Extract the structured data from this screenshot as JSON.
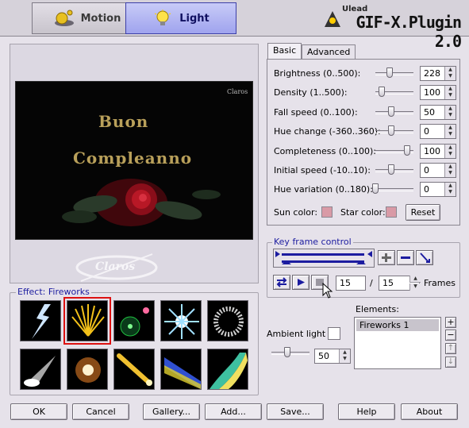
{
  "header": {
    "tabs": [
      {
        "label": "Motion",
        "active": false
      },
      {
        "label": "Light",
        "active": true
      }
    ],
    "brand_small": "Ulead",
    "brand_title": "GIF-X.Plugin 2.0"
  },
  "preview": {
    "watermark": "Claros",
    "line1": "Buon",
    "line2": "Compleanno",
    "logo_text": "Claros"
  },
  "effects": {
    "title": "Effect: Fireworks",
    "selected_index": 1,
    "thumbnails": [
      "lightning-icon",
      "fireworks-icon",
      "glow-orb-icon",
      "star-burst-icon",
      "ring-icon",
      "spotlight-icon",
      "flare-icon",
      "comet-icon",
      "light-beam-icon",
      "aurora-icon"
    ]
  },
  "param_tabs": [
    {
      "label": "Basic",
      "active": true
    },
    {
      "label": "Advanced",
      "active": false
    }
  ],
  "params": [
    {
      "label": "Brightness (0..500):",
      "value": "228",
      "level": 0.46
    },
    {
      "label": "Density (1..500):",
      "value": "100",
      "level": 0.2
    },
    {
      "label": "Fall speed (0..100):",
      "value": "50",
      "level": 0.5
    },
    {
      "label": "Hue change (-360..360):",
      "value": "0",
      "level": 0.5
    },
    {
      "label": "Completeness (0..100):",
      "value": "100",
      "level": 1.0
    },
    {
      "label": "Initial speed (-10..10):",
      "value": "0",
      "level": 0.5
    },
    {
      "label": "Hue variation (0..180):",
      "value": "0",
      "level": 0.0
    }
  ],
  "colors": {
    "sun_label": "Sun color:",
    "star_label": "Star color:",
    "sun_color": "#d99aa6",
    "star_color": "#d99aa6",
    "reset_label": "Reset"
  },
  "keyframe": {
    "title": "Key frame control",
    "current_frame": "15",
    "separator": "/",
    "total_frames": "15",
    "frames_label": "Frames"
  },
  "ambient": {
    "label": "Ambient light",
    "value": "50",
    "level": 0.5
  },
  "elements": {
    "label": "Elements:",
    "items": [
      "Fireworks 1"
    ],
    "side_buttons": [
      "+",
      "−",
      "↑",
      "↓"
    ]
  },
  "buttons": {
    "ok": "OK",
    "cancel": "Cancel",
    "gallery": "Gallery...",
    "add": "Add...",
    "save": "Save...",
    "help": "Help",
    "about": "About"
  }
}
